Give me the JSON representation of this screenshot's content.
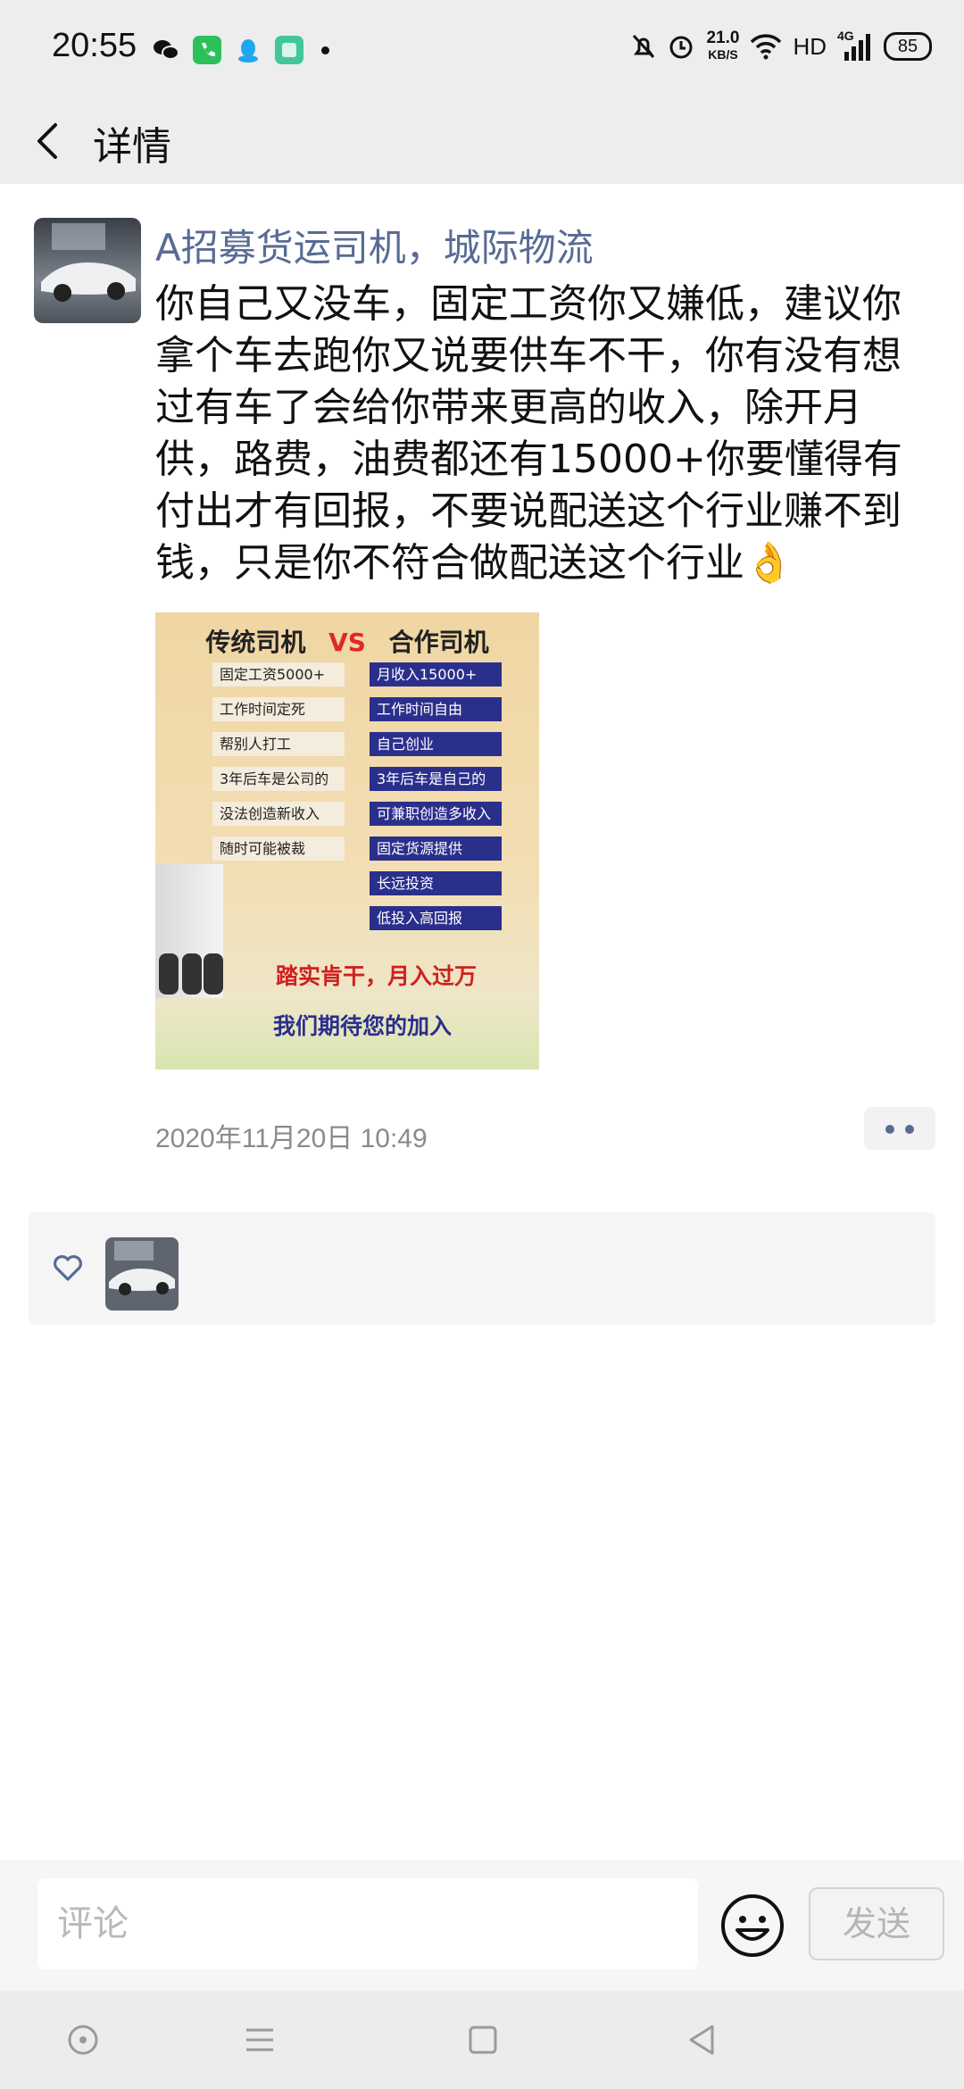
{
  "status_bar": {
    "time": "20:55",
    "network_speed_value": "21.0",
    "network_speed_unit": "KB/S",
    "hd_label": "HD",
    "signal_label": "4G",
    "battery_level": "85"
  },
  "header": {
    "title": "详情"
  },
  "post": {
    "author_name": "A招募货运司机，城际物流",
    "text": "你自己又没车，固定工资你又嫌低，建议你拿个车去跑你又说要供车不干，你有没有想过有车了会给你带来更高的收入，除开月供，路费，油费都还有15000+你要懂得有付出才有回报，不要说配送这个行业赚不到钱，只是你不符合做配送这个行业👌",
    "timestamp": "2020年11月20日 10:49",
    "image": {
      "left_title": "传统司机",
      "vs": "VS",
      "right_title": "合作司机",
      "left_items": [
        "固定工资5000+",
        "工作时间定死",
        "帮别人打工",
        "3年后车是公司的",
        "没法创造新收入",
        "随时可能被裁"
      ],
      "right_items": [
        "月收入15000+",
        "工作时间自由",
        "自己创业",
        "3年后车是自己的",
        "可兼职创造多收入",
        "固定货源提供",
        "长远投资",
        "低投入高回报"
      ],
      "slogan1": "踏实肯干，月入过万",
      "slogan2": "我们期待您的加入"
    }
  },
  "comment_bar": {
    "placeholder": "评论",
    "send_label": "发送"
  },
  "colors": {
    "link_blue": "#576b95",
    "header_bg": "#ededed",
    "image_vs_red": "#e02828",
    "image_navy": "#2b2f8c"
  },
  "icons": {
    "back": "chevron-left-icon",
    "more": "more-dots-icon",
    "like": "heart-icon",
    "emoji": "smiley-icon",
    "nav_home": "circle-dot-icon",
    "nav_menu": "menu-icon",
    "nav_recent": "square-icon",
    "nav_back": "triangle-back-icon"
  }
}
